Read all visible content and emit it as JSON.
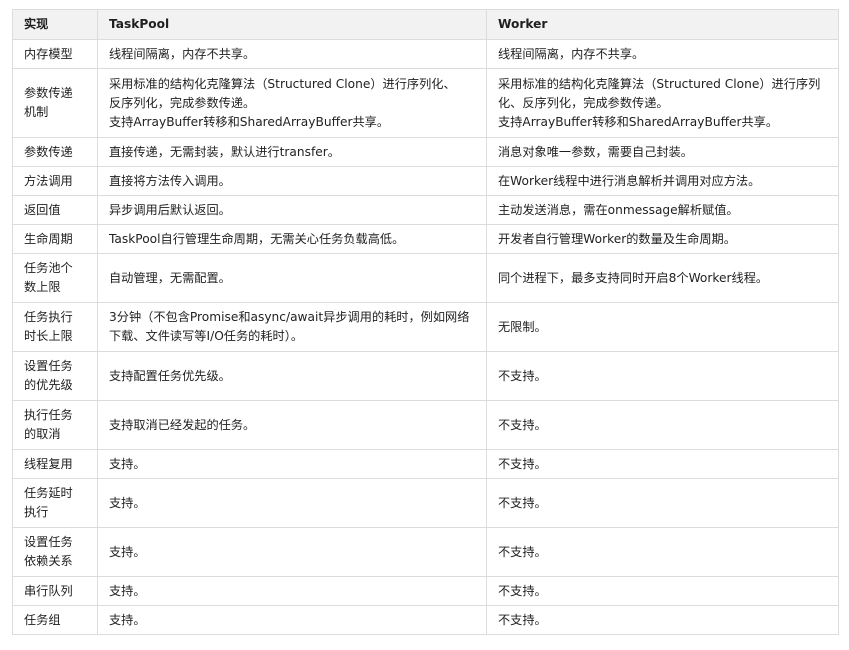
{
  "table": {
    "headers": [
      "实现",
      "TaskPool",
      "Worker"
    ],
    "rows": [
      {
        "dim": "内存模型",
        "taskpool": "线程间隔离，内存不共享。",
        "worker": "线程间隔离，内存不共享。"
      },
      {
        "dim": "参数传递\n机制",
        "taskpool": "采用标准的结构化克隆算法（Structured Clone）进行序列化、\n反序列化，完成参数传递。\n支持ArrayBuffer转移和SharedArrayBuffer共享。",
        "worker": "采用标准的结构化克隆算法（Structured Clone）进行序列\n化、反序列化，完成参数传递。\n支持ArrayBuffer转移和SharedArrayBuffer共享。"
      },
      {
        "dim": "参数传递",
        "taskpool": "直接传递，无需封装，默认进行transfer。",
        "worker": "消息对象唯一参数，需要自己封装。"
      },
      {
        "dim": "方法调用",
        "taskpool": "直接将方法传入调用。",
        "worker": "在Worker线程中进行消息解析并调用对应方法。"
      },
      {
        "dim": "返回值",
        "taskpool": "异步调用后默认返回。",
        "worker": "主动发送消息，需在onmessage解析赋值。"
      },
      {
        "dim": "生命周期",
        "taskpool": "TaskPool自行管理生命周期，无需关心任务负载高低。",
        "worker": "开发者自行管理Worker的数量及生命周期。"
      },
      {
        "dim": "任务池个\n数上限",
        "taskpool": "自动管理，无需配置。",
        "worker": "同个进程下，最多支持同时开启8个Worker线程。"
      },
      {
        "dim": "任务执行\n时长上限",
        "taskpool": "3分钟（不包含Promise和async/await异步调用的耗时，例如网络\n下载、文件读写等I/O任务的耗时）。",
        "worker": "无限制。"
      },
      {
        "dim": "设置任务\n的优先级",
        "taskpool": "支持配置任务优先级。",
        "worker": "不支持。"
      },
      {
        "dim": "执行任务\n的取消",
        "taskpool": "支持取消已经发起的任务。",
        "worker": "不支持。"
      },
      {
        "dim": "线程复用",
        "taskpool": "支持。",
        "worker": "不支持。"
      },
      {
        "dim": "任务延时\n执行",
        "taskpool": "支持。",
        "worker": "不支持。"
      },
      {
        "dim": "设置任务\n依赖关系",
        "taskpool": "支持。",
        "worker": "不支持。"
      },
      {
        "dim": "串行队列",
        "taskpool": "支持。",
        "worker": "不支持。"
      },
      {
        "dim": "任务组",
        "taskpool": "支持。",
        "worker": "不支持。"
      }
    ]
  }
}
